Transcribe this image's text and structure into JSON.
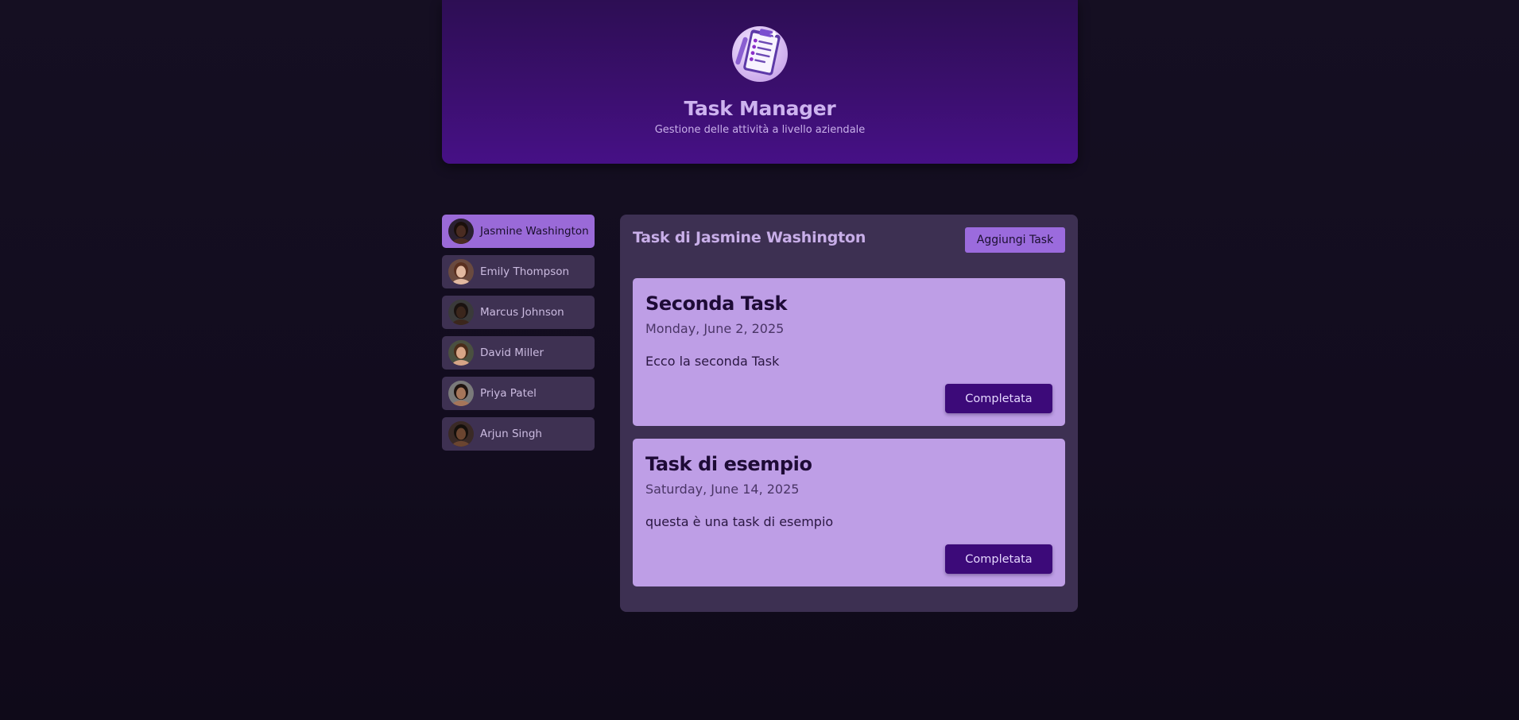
{
  "header": {
    "title": "Task Manager",
    "subtitle": "Gestione delle attività a livello aziendale",
    "logo_icon": "clipboard-checklist-icon"
  },
  "users": [
    {
      "name": "Jasmine Washington",
      "active": true,
      "skin": "#4a2c22",
      "hair": "#1a0f0b",
      "bg": "#2a2030"
    },
    {
      "name": "Emily Thompson",
      "active": false,
      "skin": "#e2b9a0",
      "hair": "#5a3020",
      "bg": "#6a4a3f"
    },
    {
      "name": "Marcus Johnson",
      "active": false,
      "skin": "#3b261c",
      "hair": "#1a1210",
      "bg": "#3a3a3a"
    },
    {
      "name": "David Miller",
      "active": false,
      "skin": "#d7a587",
      "hair": "#4a2c1a",
      "bg": "#4a5040"
    },
    {
      "name": "Priya Patel",
      "active": false,
      "skin": "#a6765a",
      "hair": "#1f1410",
      "bg": "#7a7a7a"
    },
    {
      "name": "Arjun Singh",
      "active": false,
      "skin": "#6b4530",
      "hair": "#15100c",
      "bg": "#3a2a26"
    }
  ],
  "panel": {
    "title": "Task di Jasmine Washington",
    "add_button": "Aggiungi Task"
  },
  "tasks": [
    {
      "title": "Seconda Task",
      "date": "Monday, June 2, 2025",
      "description": "Ecco la seconda Task",
      "button": "Completata"
    },
    {
      "title": "Task di esempio",
      "date": "Saturday, June 14, 2025",
      "description": "questa è una task di esempio",
      "button": "Completata"
    }
  ],
  "colors": {
    "background": "#130d20",
    "header": "#3b0f6e",
    "accent": "#9b6bdd",
    "card": "#be9ee6",
    "button_dark": "#3c0a79"
  }
}
